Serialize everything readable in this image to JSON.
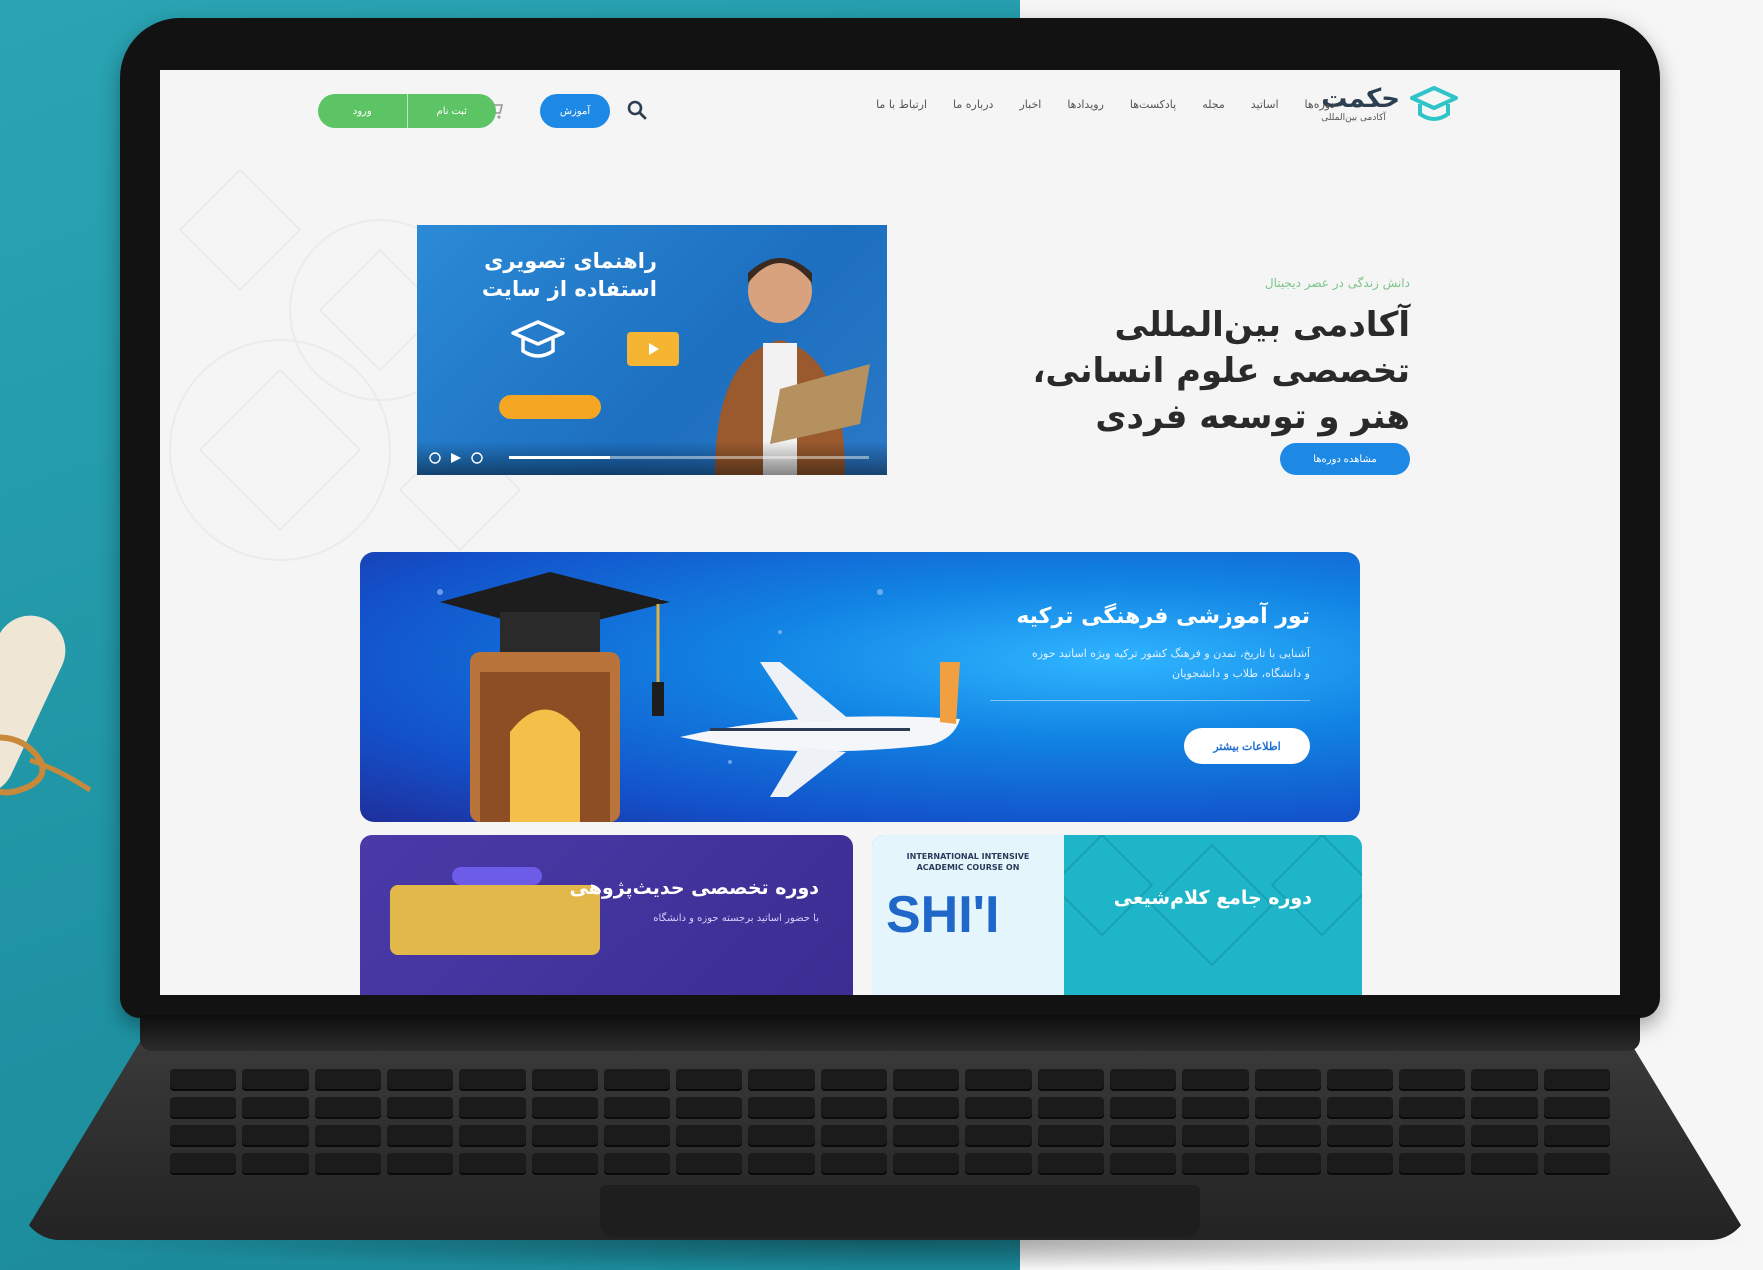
{
  "header": {
    "logo_name": "حکمت",
    "logo_sub": "آکادمی بین‌المللی",
    "nav": [
      "دوره‌ها",
      "اساتید",
      "مجله",
      "پادکست‌ها",
      "رویدادها",
      "اخبار",
      "درباره ما",
      "ارتباط با ما"
    ],
    "pill_button": "آموزش",
    "login": "ورود",
    "signup": "ثبت نام"
  },
  "hero": {
    "subtitle": "دانش زندگی در عصر دیجیتال",
    "title": "آکادمی بین‌المللی تخصصی علوم انسانی، هنر و توسعه فردی",
    "cta": "مشاهده دوره‌ها"
  },
  "video": {
    "title": "راهنمای تصویری استفاده از سایت",
    "progress": 0.28
  },
  "banner": {
    "title": "تور آموزشی فرهنگی ترکیه",
    "description": "آشنایی با تاریخ، تمدن و فرهنگ کشور ترکیه ویژه اساتید حوزه و دانشگاه، طلاب و دانشجویان",
    "cta": "اطلاعات بیشتر"
  },
  "card_hadith": {
    "title": "دوره تخصصی حدیث‌پژوهی",
    "description": "با حضور اساتید برجسته حوزه و دانشگاه"
  },
  "card_kalam": {
    "title": "دوره جامع کلام‌شیعی",
    "english_heading": "INTERNATIONAL INTENSIVE ACADEMIC COURSE ON",
    "english_big": "SHI'I"
  },
  "colors": {
    "primary_blue": "#1e88e5",
    "green": "#5cc465",
    "teal_bg": "#2aa4b3",
    "purple": "#4a3aa8"
  }
}
